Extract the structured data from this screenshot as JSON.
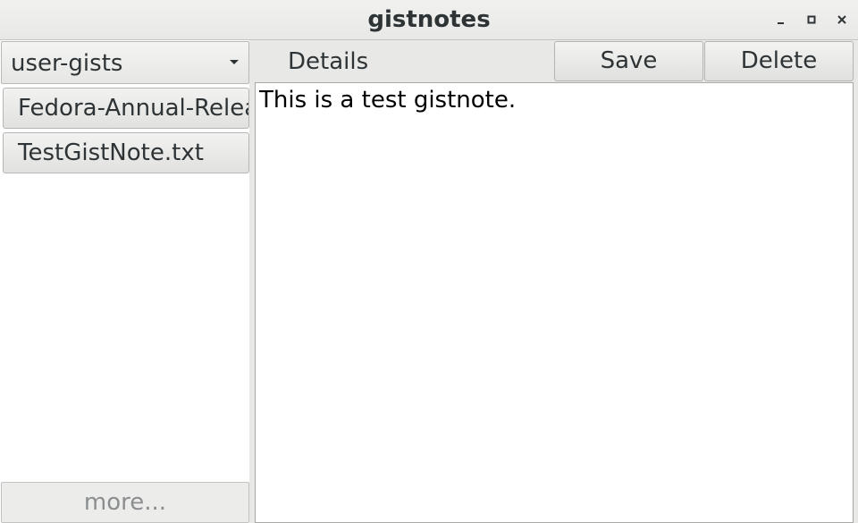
{
  "window": {
    "title": "gistnotes",
    "controls": {
      "minimize": "minimize-icon",
      "maximize": "maximize-icon",
      "close": "close-icon"
    }
  },
  "sidebar": {
    "gist_source": "user-gists",
    "items": [
      {
        "label": "Fedora-Annual-Release-Notes"
      },
      {
        "label": "TestGistNote.txt"
      }
    ],
    "more_label": "more..."
  },
  "toolbar": {
    "details_label": "Details",
    "save_label": "Save",
    "delete_label": "Delete"
  },
  "editor": {
    "content": "This is a test gistnote."
  },
  "colors": {
    "chrome": "#e8e8e7",
    "text": "#2e3436",
    "disabled_text": "#8b8e8f",
    "border": "#b6b6b4"
  }
}
